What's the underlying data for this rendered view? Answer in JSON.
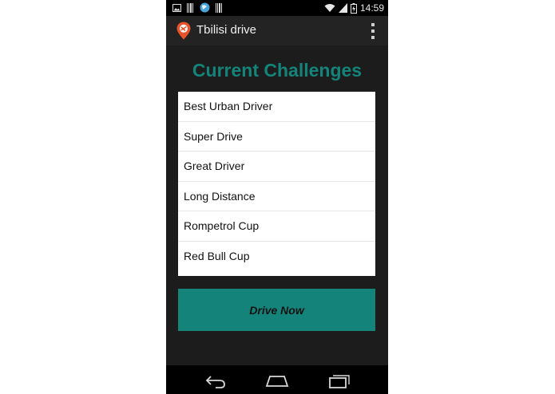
{
  "status_bar": {
    "time": "14:59",
    "icons": [
      "picture-icon",
      "barcode-icon",
      "globe-icon",
      "barcode-icon",
      "wifi-icon",
      "signal-icon",
      "battery-icon"
    ]
  },
  "action_bar": {
    "title": "Tbilisi drive",
    "app_icon": "map-pin-logo-icon",
    "overflow_icon": "overflow-menu-icon"
  },
  "main": {
    "heading": "Current Challenges",
    "challenges": [
      "Best Urban Driver",
      "Super Drive",
      "Great Driver",
      "Long Distance",
      "Rompetrol Cup",
      "Red Bull Cup"
    ],
    "drive_button_label": "Drive Now"
  },
  "nav_bar": {
    "buttons": [
      "back-icon",
      "home-icon",
      "recents-icon"
    ]
  },
  "colors": {
    "accent": "#14847a",
    "background": "#1c1c1c",
    "logo": "#e8532b"
  }
}
